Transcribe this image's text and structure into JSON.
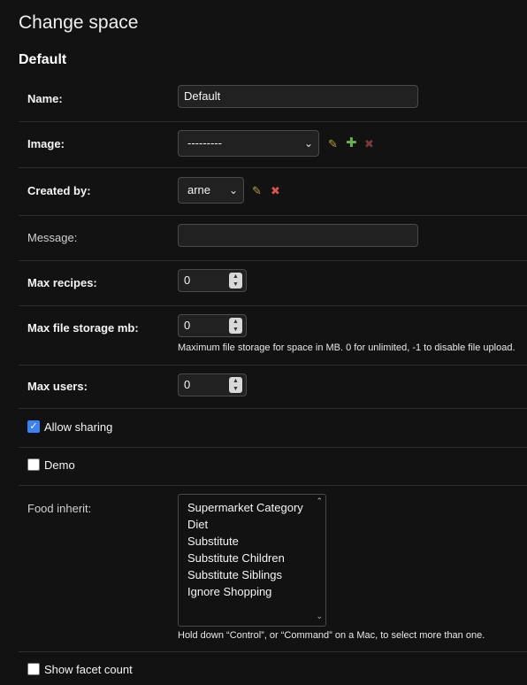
{
  "page": {
    "title": "Change space",
    "section": "Default"
  },
  "fields": {
    "name": {
      "label": "Name:",
      "value": "Default"
    },
    "image": {
      "label": "Image:",
      "selected": "---------"
    },
    "created_by": {
      "label": "Created by:",
      "selected": "arne"
    },
    "message": {
      "label": "Message:",
      "value": ""
    },
    "max_recipes": {
      "label": "Max recipes:",
      "value": "0"
    },
    "max_file_storage": {
      "label": "Max file storage mb:",
      "value": "0",
      "help": "Maximum file storage for space in MB. 0 for unlimited, -1 to disable file upload."
    },
    "max_users": {
      "label": "Max users:",
      "value": "0"
    },
    "allow_sharing": {
      "label": "Allow sharing",
      "checked": true
    },
    "demo": {
      "label": "Demo",
      "checked": false
    },
    "food_inherit": {
      "label": "Food inherit:",
      "options": [
        "Supermarket Category",
        "Diet",
        "Substitute",
        "Substitute Children",
        "Substitute Siblings",
        "Ignore Shopping"
      ],
      "help": "Hold down “Control”, or “Command” on a Mac, to select more than one."
    },
    "show_facet_count": {
      "label": "Show facet count",
      "checked": false
    }
  },
  "icons": {
    "edit": "pencil-icon",
    "add": "plus-icon",
    "delete": "x-icon",
    "dropdown": "chevron-down-icon",
    "spinner": "spinner-arrows-icon"
  },
  "colors": {
    "background": "#121212",
    "input_background": "#212121",
    "row_divider": "#2f2f2f",
    "edit_icon": "#b8a13b",
    "add_icon": "#6ab04c",
    "delete_icon": "#d9534f",
    "checkbox_checked": "#3b82f6"
  }
}
